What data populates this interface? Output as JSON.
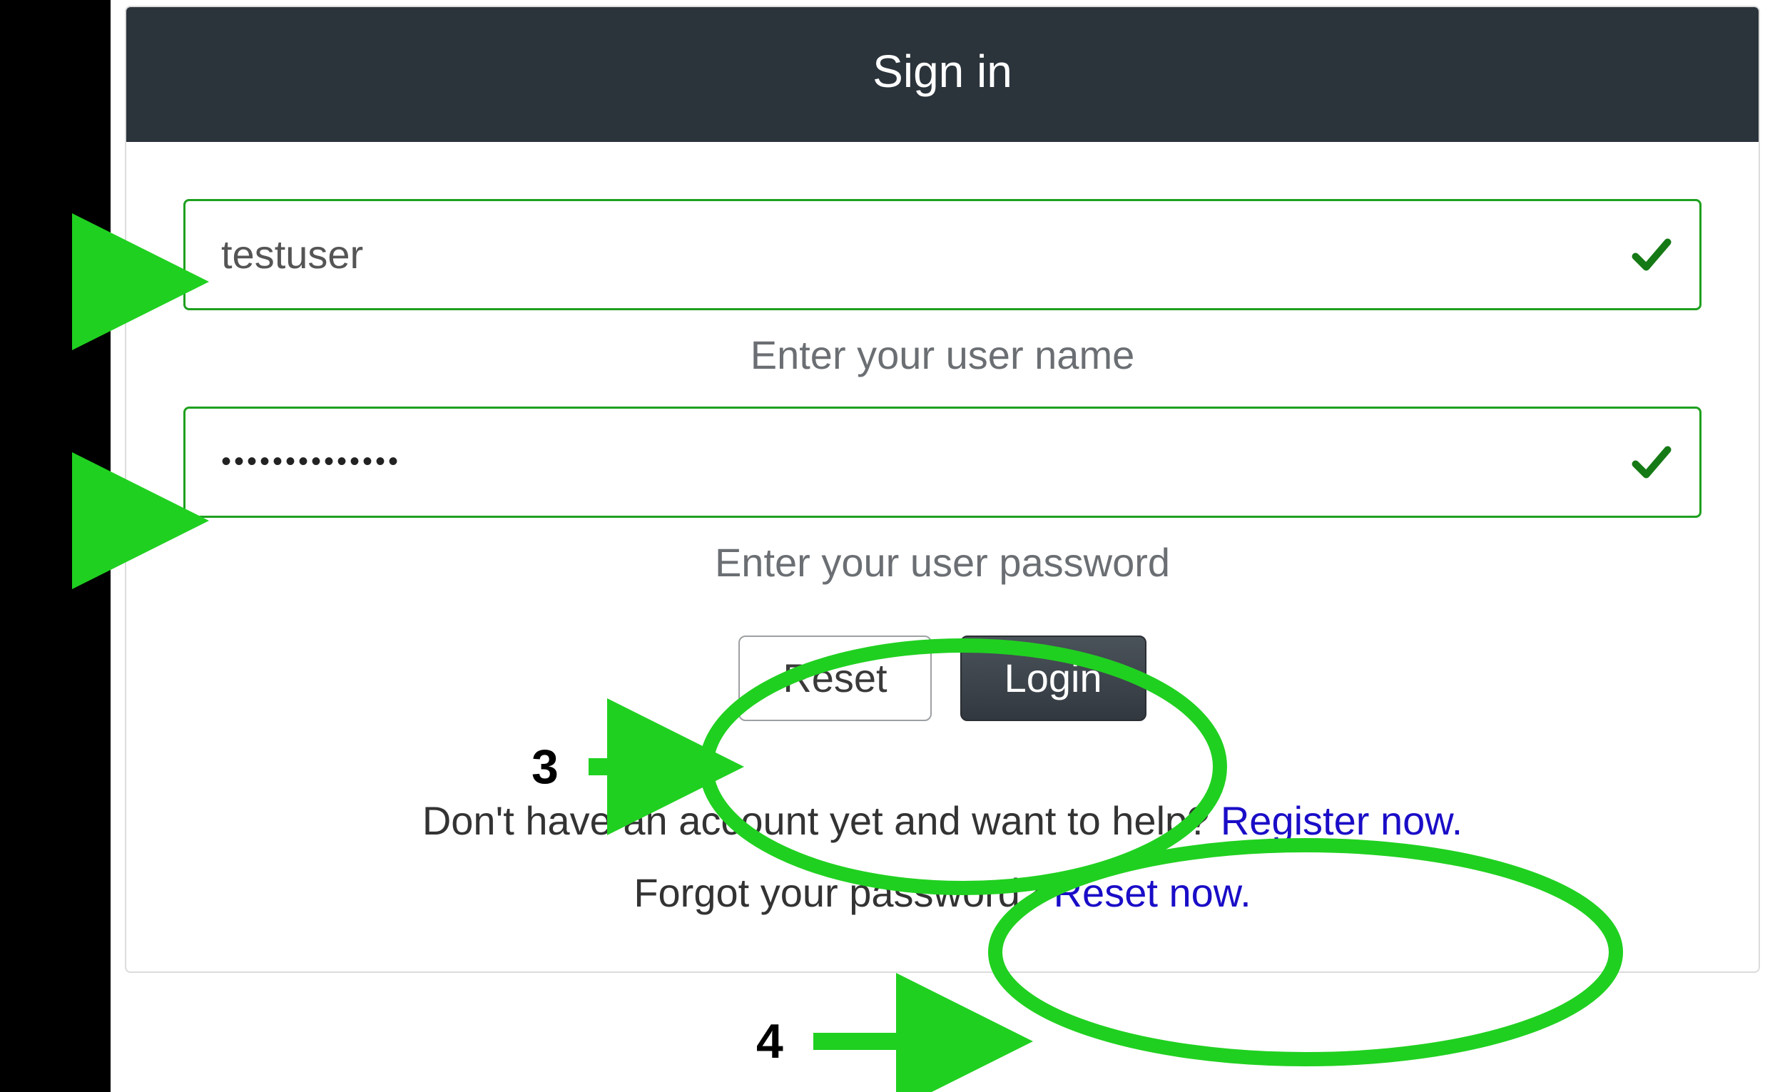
{
  "panel": {
    "title": "Sign in"
  },
  "username": {
    "value": "testuser",
    "help": "Enter your user name"
  },
  "password": {
    "value": "••••••••••••••",
    "help": "Enter your user password"
  },
  "buttons": {
    "reset": "Reset",
    "login": "Login"
  },
  "register_line": {
    "text": "Don't have an account yet and want to help? ",
    "link": "Register now."
  },
  "forgot_line": {
    "text": "Forgot your password? ",
    "link": "Reset now."
  },
  "annotations": {
    "label3": "3",
    "label4": "4"
  },
  "colors": {
    "valid_border": "#1fa01f",
    "check": "#157a15",
    "annotation": "#20d020",
    "header_bg": "#2b333b",
    "link": "#1a0dc7"
  }
}
